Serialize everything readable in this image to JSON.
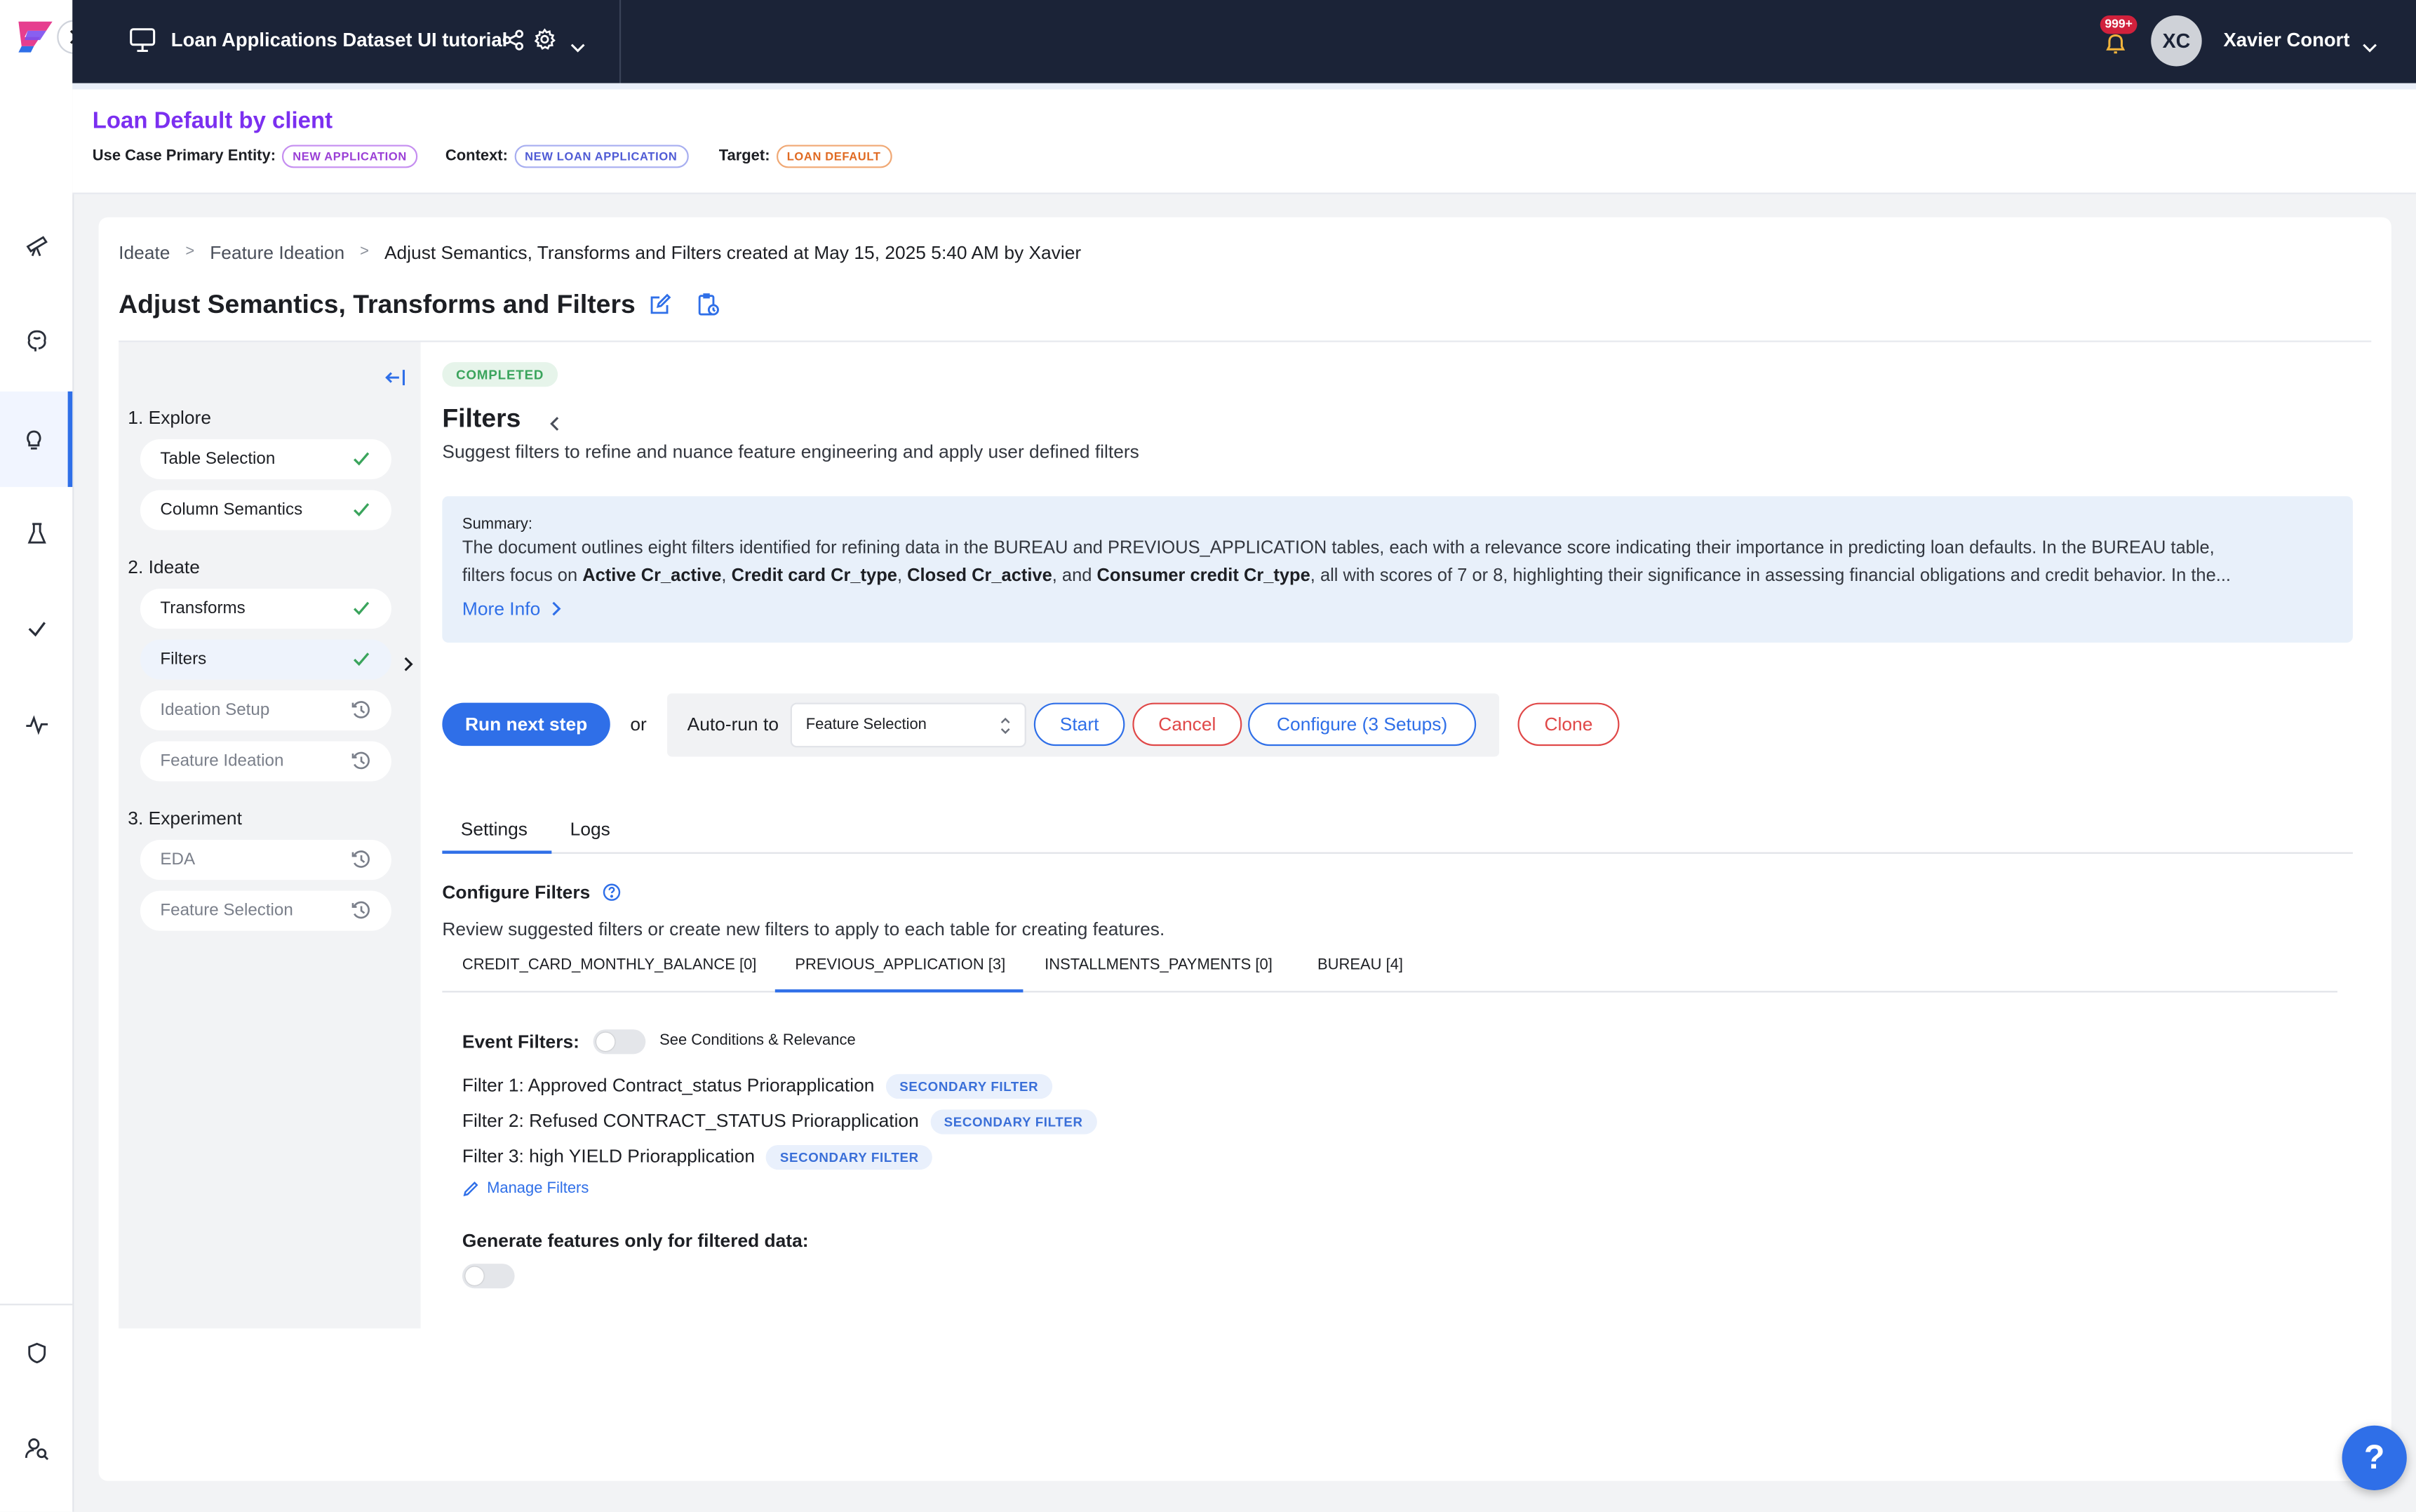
{
  "app": {
    "project_title": "Loan Applications Dataset UI tutorial",
    "notification_count": "999+",
    "user_initials": "XC",
    "user_name": "Xavier Conort"
  },
  "usecase": {
    "title": "Loan Default by client",
    "entity_label": "Use Case Primary Entity:",
    "entity_value": "NEW APPLICATION",
    "context_label": "Context:",
    "context_value": "NEW LOAN APPLICATION",
    "target_label": "Target:",
    "target_value": "LOAN DEFAULT"
  },
  "breadcrumb": {
    "items": [
      "Ideate",
      "Feature Ideation",
      "Adjust Semantics, Transforms and Filters created at May 15, 2025 5:40 AM by Xavier"
    ],
    "separator": ">"
  },
  "page": {
    "title": "Adjust Semantics, Transforms and Filters"
  },
  "steps": {
    "sections": [
      {
        "label": "1. Explore",
        "items": [
          {
            "label": "Table Selection",
            "status": "done"
          },
          {
            "label": "Column Semantics",
            "status": "done"
          }
        ]
      },
      {
        "label": "2. Ideate",
        "items": [
          {
            "label": "Transforms",
            "status": "done"
          },
          {
            "label": "Filters",
            "status": "done"
          },
          {
            "label": "Ideation Setup",
            "status": "pending"
          },
          {
            "label": "Feature Ideation",
            "status": "pending"
          }
        ]
      },
      {
        "label": "3. Experiment",
        "items": [
          {
            "label": "EDA",
            "status": "pending"
          },
          {
            "label": "Feature Selection",
            "status": "pending"
          }
        ]
      }
    ]
  },
  "step_detail": {
    "status": "COMPLETED",
    "title": "Filters",
    "subtitle": "Suggest filters to refine and nuance feature engineering and apply user defined filters",
    "summary_label": "Summary:",
    "summary_line1": "The document outlines eight filters identified for refining data in the BUREAU and PREVIOUS_APPLICATION tables, each with a relevance score indicating their importance in predicting loan defaults. In the BUREAU table,",
    "summary_line2": {
      "pre": "filters focus on ",
      "b1": "Active Cr_active",
      "s1": ", ",
      "b2": "Credit card Cr_type",
      "s2": ", ",
      "b3": "Closed Cr_active",
      "s3": ", and ",
      "b4": "Consumer credit Cr_type",
      "post": ", all with scores of 7 or 8, highlighting their significance in assessing financial obligations and credit behavior. In the..."
    },
    "more_info": "More Info"
  },
  "actions": {
    "run_next": "Run next step",
    "or": "or",
    "autorun_label": "Auto-run to",
    "autorun_value": "Feature Selection",
    "start": "Start",
    "cancel": "Cancel",
    "configure": "Configure (3 Setups)",
    "clone": "Clone"
  },
  "tabs": {
    "items": [
      "Settings",
      "Logs"
    ],
    "active": "Settings"
  },
  "configure_filters": {
    "title": "Configure Filters",
    "description": "Review suggested filters or create new filters to apply to each table for creating features.",
    "table_tabs": [
      "CREDIT_CARD_MONTHLY_BALANCE [0]",
      "PREVIOUS_APPLICATION [3]",
      "INSTALLMENTS_PAYMENTS [0]",
      "BUREAU [4]"
    ],
    "active_table": "PREVIOUS_APPLICATION [3]",
    "event_filters_label": "Event Filters:",
    "toggle_label": "See Conditions & Relevance",
    "filters": [
      {
        "text": "Filter 1: Approved Contract_status Priorapplication",
        "badge": "SECONDARY FILTER"
      },
      {
        "text": "Filter 2: Refused CONTRACT_STATUS Priorapplication",
        "badge": "SECONDARY FILTER"
      },
      {
        "text": "Filter 3: high YIELD Priorapplication",
        "badge": "SECONDARY FILTER"
      }
    ],
    "manage_filters": "Manage Filters",
    "generate_label": "Generate features only for filtered data:"
  },
  "help": {
    "label": "?"
  },
  "colors": {
    "topbar": "#1b2337",
    "primary": "#2f6fe8",
    "purple": "#7b2ff0",
    "danger": "#e04848",
    "success": "#3aa45c"
  }
}
